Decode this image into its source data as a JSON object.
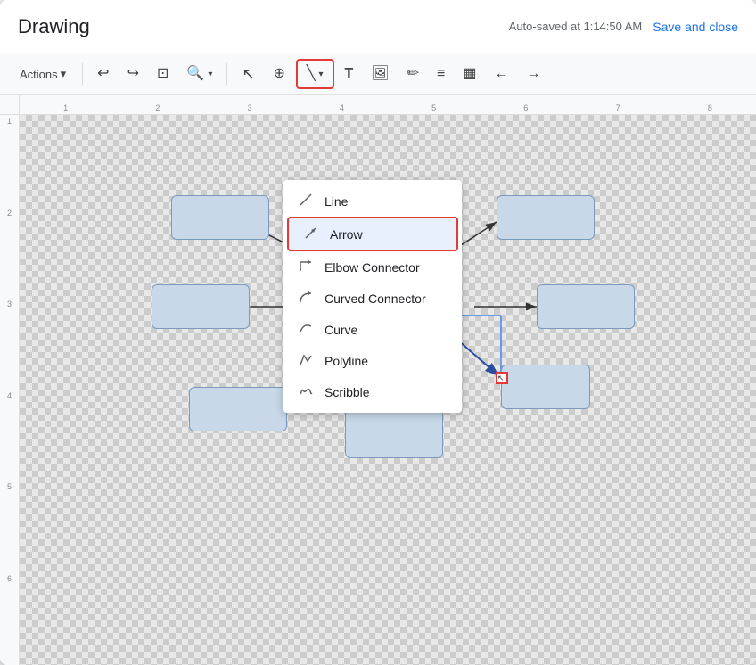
{
  "title": "Drawing",
  "autosave": "Auto-saved at 1:14:50 AM",
  "saveClose": "Save and close",
  "toolbar": {
    "actions": "Actions",
    "tools": [
      {
        "name": "undo",
        "icon": "↩",
        "label": "Undo"
      },
      {
        "name": "redo",
        "icon": "↪",
        "label": "Redo"
      },
      {
        "name": "select",
        "icon": "⊡",
        "label": "Select"
      },
      {
        "name": "zoom",
        "icon": "🔍",
        "label": "Zoom"
      },
      {
        "name": "cursor",
        "icon": "↖",
        "label": "Cursor"
      },
      {
        "name": "pan",
        "icon": "⊕",
        "label": "Pan"
      },
      {
        "name": "line",
        "icon": "╲",
        "label": "Line Tool",
        "active": true
      },
      {
        "name": "text",
        "icon": "T",
        "label": "Text"
      },
      {
        "name": "image",
        "icon": "🖼",
        "label": "Image"
      },
      {
        "name": "paint",
        "icon": "✏",
        "label": "Paint"
      },
      {
        "name": "format",
        "icon": "≡",
        "label": "Format"
      },
      {
        "name": "table",
        "icon": "▦",
        "label": "Table"
      },
      {
        "name": "arrow-left",
        "icon": "←",
        "label": "Arrow Left"
      },
      {
        "name": "arrow-right",
        "icon": "→",
        "label": "Arrow Right"
      }
    ]
  },
  "menu": {
    "items": [
      {
        "id": "line",
        "label": "Line",
        "icon": "—"
      },
      {
        "id": "arrow",
        "label": "Arrow",
        "icon": "↗",
        "selected": true
      },
      {
        "id": "elbow",
        "label": "Elbow Connector",
        "icon": "⌐"
      },
      {
        "id": "curved-connector",
        "label": "Curved Connector",
        "icon": "∫"
      },
      {
        "id": "curve",
        "label": "Curve",
        "icon": "〜"
      },
      {
        "id": "polyline",
        "label": "Polyline",
        "icon": "∧"
      },
      {
        "id": "scribble",
        "label": "Scribble",
        "icon": "✒"
      }
    ]
  },
  "ruler": {
    "hTicks": [
      "1",
      "2",
      "3",
      "4",
      "5",
      "6",
      "7",
      "8"
    ],
    "vTicks": [
      "1",
      "2",
      "3",
      "4",
      "5",
      "6"
    ]
  }
}
